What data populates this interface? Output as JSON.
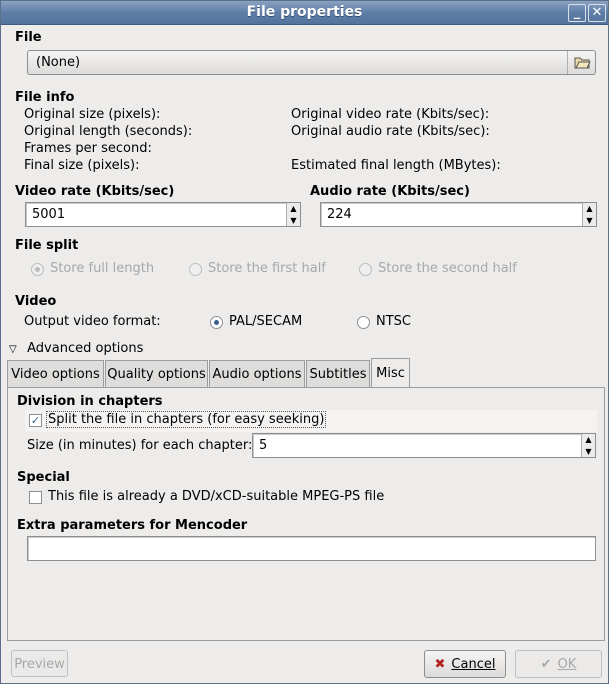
{
  "window": {
    "title": "File properties"
  },
  "file": {
    "heading": "File",
    "value": "(None)"
  },
  "file_info": {
    "heading": "File info",
    "labels_left": [
      "Original size (pixels):",
      "Original length (seconds):",
      "Frames per second:",
      "Final size (pixels):"
    ],
    "labels_right": [
      "Original video rate (Kbits/sec):",
      "Original audio rate (Kbits/sec):",
      "Estimated final length (MBytes):"
    ]
  },
  "video_rate": {
    "label": "Video rate (Kbits/sec)",
    "value": "5001"
  },
  "audio_rate": {
    "label": "Audio rate (Kbits/sec)",
    "value": "224"
  },
  "file_split": {
    "heading": "File split",
    "options": [
      "Store full length",
      "Store the first half",
      "Store the second half"
    ],
    "selected": 0
  },
  "video": {
    "heading": "Video",
    "format_label": "Output video format:",
    "options": [
      "PAL/SECAM",
      "NTSC"
    ],
    "selected": 0
  },
  "advanced": {
    "label": "Advanced options"
  },
  "tabs": [
    "Video options",
    "Quality options",
    "Audio options",
    "Subtitles",
    "Misc"
  ],
  "active_tab": "Misc",
  "misc": {
    "division_heading": "Division in chapters",
    "split_label": "Split the file in chapters (for easy seeking)",
    "split_checked": true,
    "chapter_size_label": "Size (in minutes) for each chapter:",
    "chapter_size_value": "5",
    "special_heading": "Special",
    "dvd_label": "This file is already a DVD/xCD-suitable MPEG-PS file",
    "dvd_checked": false,
    "extra_heading": "Extra parameters for Mencoder",
    "extra_value": ""
  },
  "buttons": {
    "preview": "Preview",
    "cancel": "Cancel",
    "ok": "OK"
  },
  "icons": {
    "minimize": "minimize-icon",
    "close": "close-icon",
    "folder": "folder-open-icon"
  },
  "colors": {
    "titlebar": "#5f7ea7",
    "accent": "#3b5f8f",
    "window_bg": "#edeceb"
  }
}
